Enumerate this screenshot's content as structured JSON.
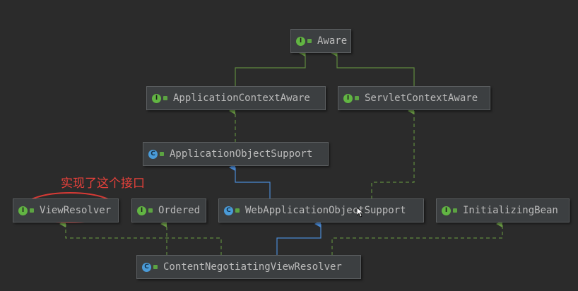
{
  "nodes": [
    {
      "id": "aware",
      "kind": "interface",
      "badge": "I",
      "label": "Aware"
    },
    {
      "id": "application-context-aware",
      "kind": "interface",
      "badge": "I",
      "label": "ApplicationContextAware"
    },
    {
      "id": "servlet-context-aware",
      "kind": "interface",
      "badge": "I",
      "label": "ServletContextAware"
    },
    {
      "id": "application-object-support",
      "kind": "class",
      "badge": "C",
      "label": "ApplicationObjectSupport"
    },
    {
      "id": "view-resolver",
      "kind": "interface",
      "badge": "I",
      "label": "ViewResolver"
    },
    {
      "id": "ordered",
      "kind": "interface",
      "badge": "I",
      "label": "Ordered"
    },
    {
      "id": "web-application-object-support",
      "kind": "class",
      "badge": "C",
      "label": "WebApplicationObjectSupport"
    },
    {
      "id": "initializing-bean",
      "kind": "interface",
      "badge": "I",
      "label": "InitializingBean"
    },
    {
      "id": "content-negotiating-view-resolver",
      "kind": "class",
      "badge": "C",
      "label": "ContentNegotiatingViewResolver"
    }
  ],
  "relations": [
    {
      "from": "application-context-aware",
      "to": "aware",
      "type": "extends-interface"
    },
    {
      "from": "servlet-context-aware",
      "to": "aware",
      "type": "extends-interface"
    },
    {
      "from": "application-object-support",
      "to": "application-context-aware",
      "type": "implements"
    },
    {
      "from": "web-application-object-support",
      "to": "application-object-support",
      "type": "extends"
    },
    {
      "from": "web-application-object-support",
      "to": "servlet-context-aware",
      "type": "implements"
    },
    {
      "from": "content-negotiating-view-resolver",
      "to": "view-resolver",
      "type": "implements"
    },
    {
      "from": "content-negotiating-view-resolver",
      "to": "ordered",
      "type": "implements"
    },
    {
      "from": "content-negotiating-view-resolver",
      "to": "web-application-object-support",
      "type": "extends"
    },
    {
      "from": "content-negotiating-view-resolver",
      "to": "initializing-bean",
      "type": "implements"
    }
  ],
  "annotation": {
    "text": "实现了这个接口",
    "target": "view-resolver"
  },
  "colors": {
    "background": "#2b2b2b",
    "node_fill": "#3c3f41",
    "node_border": "#5b5e60",
    "text": "#bbbbbb",
    "interface_badge": "#62b543",
    "class_badge": "#4a9bd8",
    "implements_line": "#5f8a3f",
    "extends_line": "#4a8ad4",
    "annotation": "#e8413b"
  }
}
